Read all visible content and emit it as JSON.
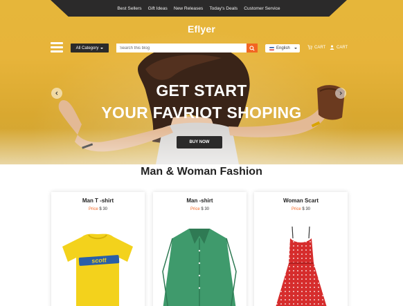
{
  "topnav": {
    "links": [
      "Best Sellers",
      "Gift Ideas",
      "New Releases",
      "Today's Deals",
      "Customer Service"
    ]
  },
  "header": {
    "logo": "Eflyer",
    "category_label": "All Category",
    "search_placeholder": "Search this blog",
    "language": "English",
    "cart1": "CART",
    "cart2": "CART"
  },
  "hero": {
    "line1": "GET START",
    "line2": "YOUR FAVRIOT SHOPING",
    "button": "BUY NOW"
  },
  "section": {
    "title": "Man & Woman Fashion",
    "products": [
      {
        "name": "Man T -shirt",
        "price_label": "Price",
        "price": "$ 30",
        "print": "scott"
      },
      {
        "name": "Man -shirt",
        "price_label": "Price",
        "price": "$ 30"
      },
      {
        "name": "Woman Scart",
        "price_label": "Price",
        "price": "$ 30"
      }
    ]
  },
  "colors": {
    "hero_yellow": "#e6b63a",
    "dark": "#2b2a2a",
    "accent_orange": "#f26522"
  }
}
